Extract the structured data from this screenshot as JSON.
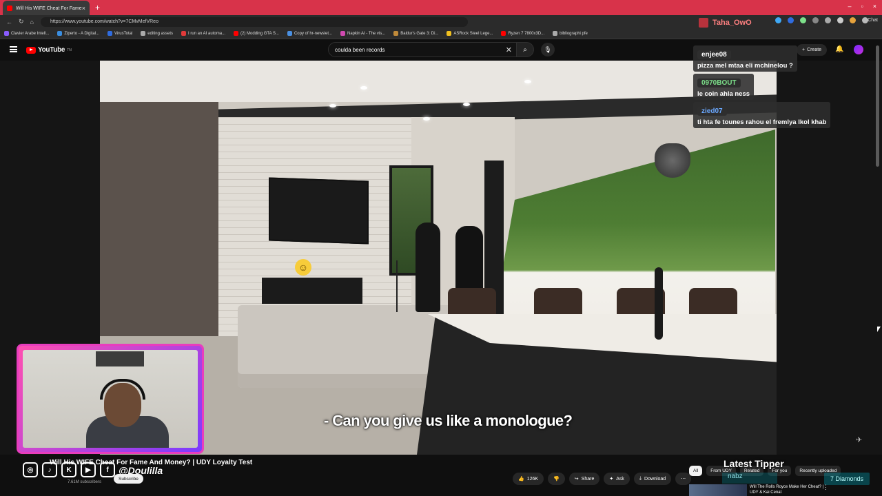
{
  "browser": {
    "tab_title": "Will His WIFE Cheat For Fame",
    "url": "https://www.youtube.com/watch?v=7CMvMefVReo",
    "chat_label": "Chat",
    "bookmarks": [
      {
        "label": "Clavier Arabe Intell...",
        "color": "#8a5cff"
      },
      {
        "label": "Ziperto - A Digital...",
        "color": "#3a8de0"
      },
      {
        "label": "VirusTotal",
        "color": "#2f6ce0"
      },
      {
        "label": "editing assets",
        "color": "#aaaaaa"
      },
      {
        "label": "I run an AI automa...",
        "color": "#e03a3a"
      },
      {
        "label": "(2) Modding GTA S...",
        "color": "#ff0000"
      },
      {
        "label": "Copy of hr-newslet...",
        "color": "#4a90e2"
      },
      {
        "label": "Napkin AI - The vis...",
        "color": "#d04ab0"
      },
      {
        "label": "Baldur's Gate 3: Di...",
        "color": "#c08a3a"
      },
      {
        "label": "ASRock Steel Lege...",
        "color": "#f0c020"
      },
      {
        "label": "Ryzen 7 7800x3D...",
        "color": "#ff0000"
      },
      {
        "label": "bibliographi pfe",
        "color": "#aaaaaa"
      }
    ]
  },
  "youtube": {
    "logo_text": "YouTube",
    "logo_sup": "TN",
    "search_value": "coulda been records",
    "create_label": "Create"
  },
  "video": {
    "subtitle": "- Can you give us like a monologue?",
    "title": "Will His WIFE Cheat For Fame And Money? | UDY Loyalty Test"
  },
  "chat": {
    "host": "Taha_OwO",
    "messages": [
      {
        "user": "enjee08",
        "text": "pizza mel mtaa eli mchinelou ?",
        "color": "#ffffff"
      },
      {
        "user": "0970BOUT",
        "text": "le coin ahla ness",
        "color": "#7de08a"
      },
      {
        "user": "zied07",
        "text": "ti hta fe tounes rahou el fremlya lkol khab",
        "color": "#6aa8ff"
      }
    ]
  },
  "overlay": {
    "handle": "@Doulilla",
    "social_icons": [
      "instagram-icon",
      "tiktok-icon",
      "kick-icon",
      "youtube-icon",
      "facebook-icon"
    ],
    "latest_tipper_label": "Latest Tipper",
    "tipper_name": "nabz",
    "tipper_amount": "7 Diamonds"
  },
  "channel": {
    "subscribers": "7.61M subscribers",
    "subscribe_label": "Subscribe"
  },
  "actions": {
    "likes": "126K",
    "share": "Share",
    "ask": "Ask",
    "download": "Download"
  },
  "chips": [
    "All",
    "From UDY",
    "Related",
    "For you",
    "Recently uploaded"
  ],
  "recommended": {
    "title": "Will The Rolls Royce Make Her Cheat? | UDY & Kai Cenat"
  },
  "colors": {
    "accent": "#ff0000",
    "tabbar": "#d8334a",
    "cam_border": "#e83dbd"
  }
}
